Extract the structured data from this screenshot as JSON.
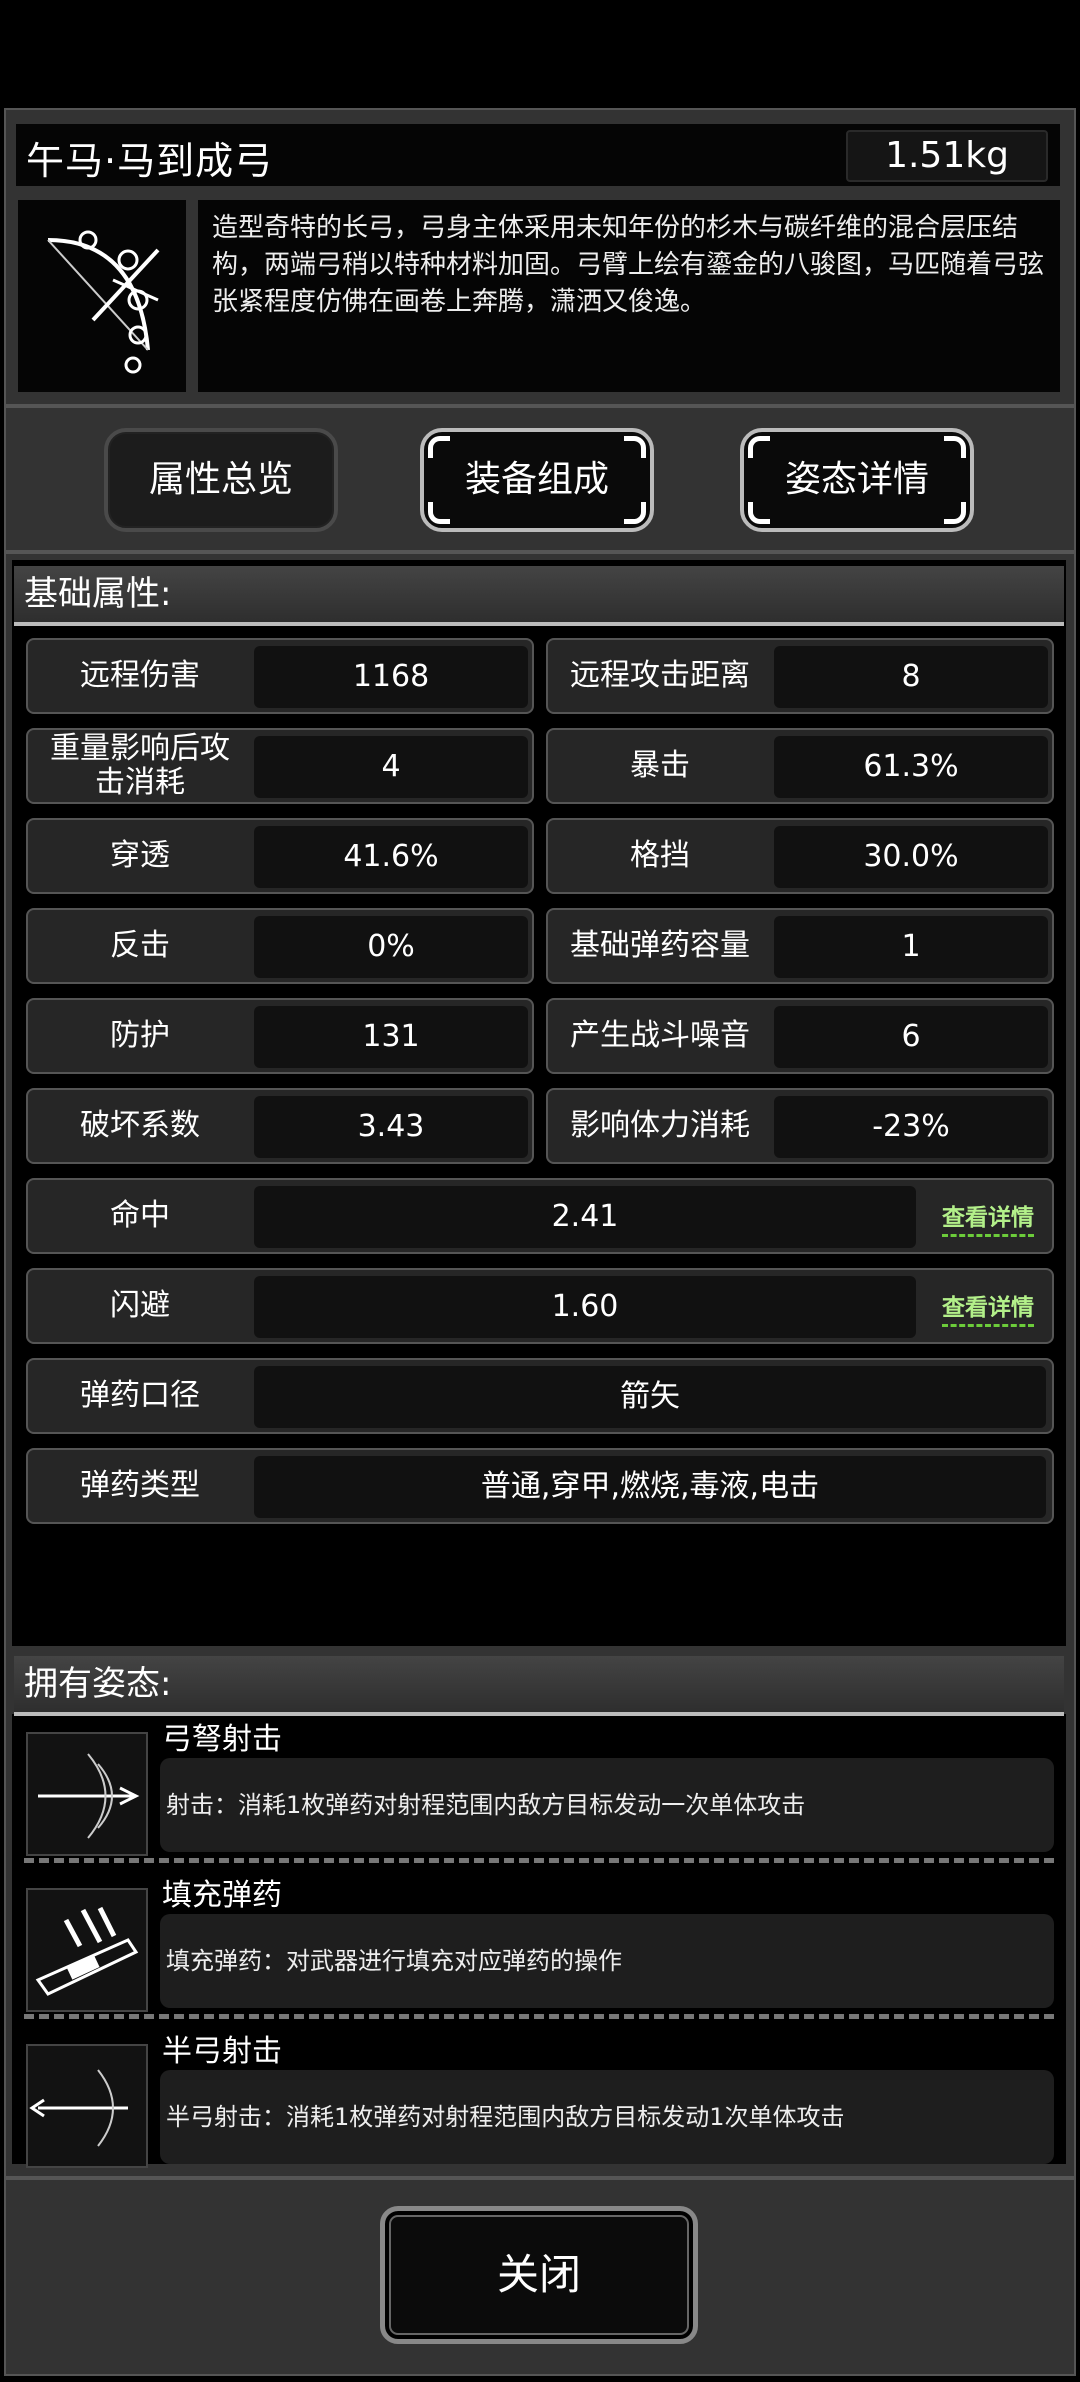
{
  "header": {
    "title": "午马·马到成弓",
    "weight": "1.51kg"
  },
  "description": "造型奇特的长弓，弓身主体采用未知年份的杉木与碳纤维的混合层压结构，两端弓稍以特种材料加固。弓臂上绘有鎏金的八骏图，马匹随着弓弦张紧程度仿佛在画卷上奔腾，潇洒又俊逸。",
  "tabs": [
    {
      "label": "属性总览"
    },
    {
      "label": "装备组成"
    },
    {
      "label": "姿态详情"
    }
  ],
  "attributes": {
    "heading": "基础属性:",
    "pairs": [
      {
        "label": "远程伤害",
        "value": "1168"
      },
      {
        "label": "远程攻击距离",
        "value": "8"
      },
      {
        "label": "重量影响后攻击消耗",
        "value": "4"
      },
      {
        "label": "暴击",
        "value": "61.3%"
      },
      {
        "label": "穿透",
        "value": "41.6%"
      },
      {
        "label": "格挡",
        "value": "30.0%"
      },
      {
        "label": "反击",
        "value": "0%"
      },
      {
        "label": "基础弹药容量",
        "value": "1"
      },
      {
        "label": "防护",
        "value": "131"
      },
      {
        "label": "产生战斗噪音",
        "value": "6"
      },
      {
        "label": "破坏系数",
        "value": "3.43"
      },
      {
        "label": "影响体力消耗",
        "value": "-23%"
      }
    ],
    "wide": [
      {
        "label": "命中",
        "value": "2.41",
        "link": "查看详情"
      },
      {
        "label": "闪避",
        "value": "1.60",
        "link": "查看详情"
      },
      {
        "label": "弹药口径",
        "value": "箭矢"
      },
      {
        "label": "弹药类型",
        "value": "普通,穿甲,燃烧,毒液,电击"
      }
    ]
  },
  "stances": {
    "heading": "拥有姿态:",
    "items": [
      {
        "name": "弓弩射击",
        "desc": "射击：消耗1枚弹药对射程范围内敌方目标发动一次单体攻击",
        "icon": "bow-shot-icon"
      },
      {
        "name": "填充弹药",
        "desc": "填充弹药：对武器进行填充对应弹药的操作",
        "icon": "reload-icon"
      },
      {
        "name": "半弓射击",
        "desc": "半弓射击：消耗1枚弹药对射程范围内敌方目标发动1次单体攻击",
        "icon": "half-bow-icon"
      }
    ]
  },
  "close_label": "关闭"
}
